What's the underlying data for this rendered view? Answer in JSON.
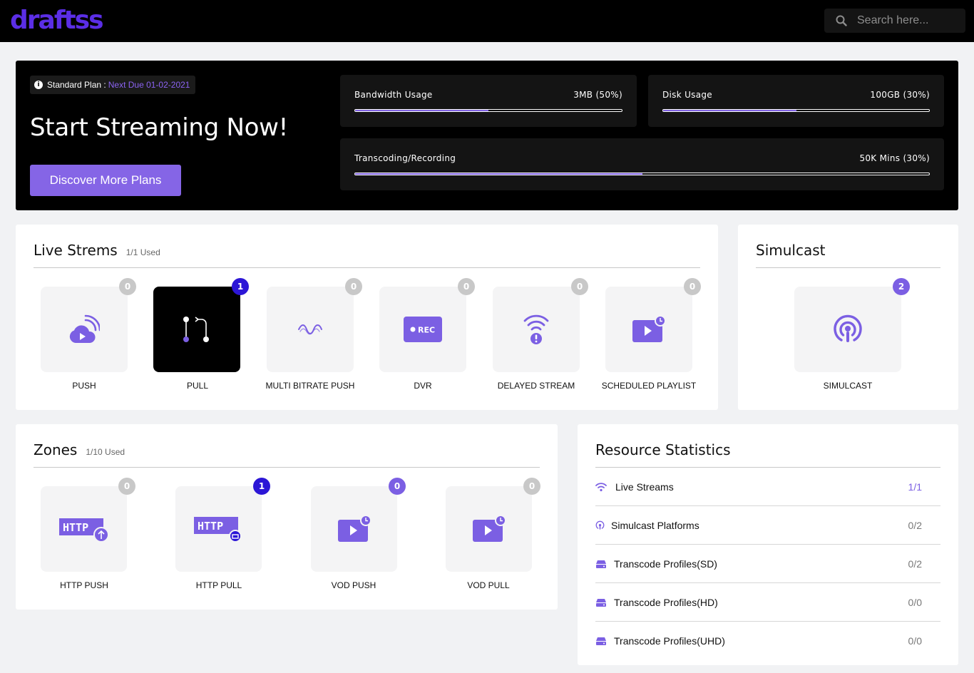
{
  "brand": {
    "logo": "draftss",
    "accent": "#7b5fe3"
  },
  "search": {
    "placeholder": "Search here...",
    "icon": "search-icon"
  },
  "hero": {
    "plan_label": "Standard Plan :",
    "plan_due": "Next Due 01-02-2021",
    "title": "Start Streaming Now!",
    "cta_label": "Discover More Plans",
    "usage": [
      {
        "label": "Bandwidth Usage",
        "value": "3MB (50%)",
        "percent": 50
      },
      {
        "label": "Disk Usage",
        "value": "100GB (30%)",
        "percent": 50
      },
      {
        "label": "Transcoding/Recording",
        "value": "50K Mins (30%)",
        "percent": 50
      }
    ]
  },
  "live_streams": {
    "title": "Live Strems",
    "used": "1/1 Used",
    "tiles": [
      {
        "label": "PUSH",
        "count": "0",
        "icon": "cloud-broadcast-icon"
      },
      {
        "label": "PULL",
        "count": "1",
        "icon": "pull-path-icon",
        "active": true
      },
      {
        "label": "MULTI BITRATE PUSH",
        "count": "0",
        "icon": "wave-icon"
      },
      {
        "label": "DVR",
        "count": "0",
        "icon": "rec-icon"
      },
      {
        "label": "DELAYED STREAM",
        "count": "0",
        "icon": "wifi-alert-icon"
      },
      {
        "label": "SCHEDULED PLAYLIST",
        "count": "0",
        "icon": "video-clock-icon"
      }
    ]
  },
  "simulcast": {
    "title": "Simulcast",
    "tiles": [
      {
        "label": "SIMULCAST",
        "count": "2",
        "icon": "podcast-icon"
      }
    ]
  },
  "zones": {
    "title": "Zones",
    "used": "1/10 Used",
    "tiles": [
      {
        "label": "HTTP PUSH",
        "count": "0",
        "icon": "http-upload-icon",
        "http": "HTTP"
      },
      {
        "label": "HTTP PULL",
        "count": "1",
        "icon": "http-download-icon",
        "http": "HTTP"
      },
      {
        "label": "VOD PUSH",
        "count": "0",
        "icon": "video-clock-icon"
      },
      {
        "label": "VOD PULL",
        "count": "0",
        "icon": "video-clock-icon"
      }
    ]
  },
  "resources": {
    "title": "Resource Statistics",
    "rows": [
      {
        "label": "Live Streams",
        "value": "1/1",
        "icon": "wifi-icon"
      },
      {
        "label": "Simulcast Platforms",
        "value": "0/2",
        "icon": "podcast-icon"
      },
      {
        "label": "Transcode Profiles(SD)",
        "value": "0/2",
        "icon": "server-icon"
      },
      {
        "label": "Transcode Profiles(HD)",
        "value": "0/0",
        "icon": "server-icon"
      },
      {
        "label": "Transcode Profiles(UHD)",
        "value": "0/0",
        "icon": "server-icon"
      }
    ]
  }
}
